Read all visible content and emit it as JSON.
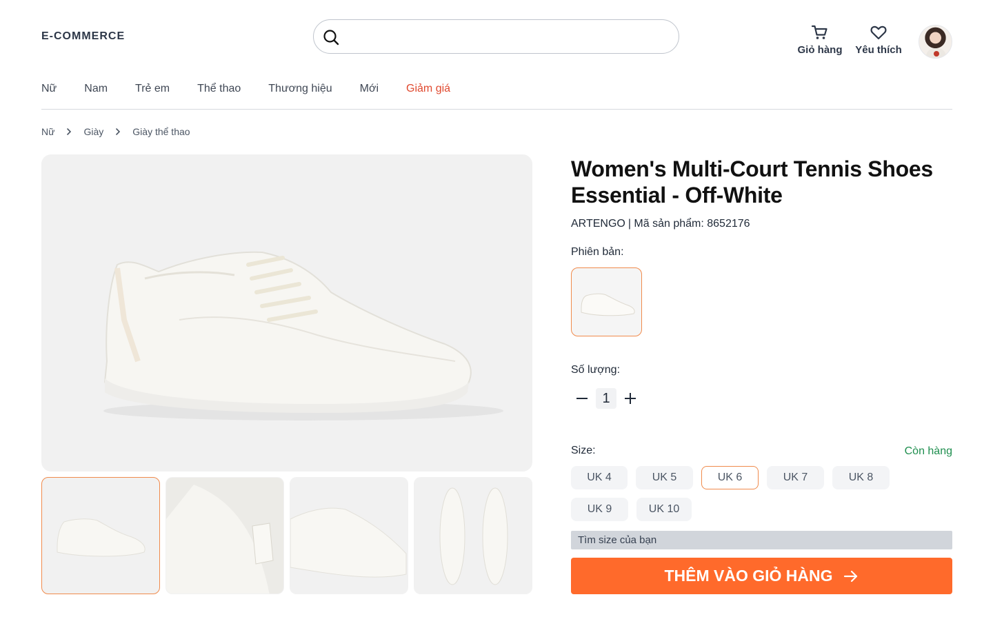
{
  "header": {
    "logo": "E-COMMERCE",
    "search_placeholder": "",
    "cart_label": "Giỏ hàng",
    "favorites_label": "Yêu thích"
  },
  "nav": {
    "items": [
      "Nữ",
      "Nam",
      "Trẻ em",
      "Thể thao",
      "Thương hiệu",
      "Mới",
      "Giảm giá"
    ],
    "sale_color": "#e0492f"
  },
  "breadcrumb": [
    "Nữ",
    "Giày",
    "Giày thể thao"
  ],
  "product": {
    "title": "Women's Multi-Court Tennis Shoes Essential - Off-White",
    "brand": "ARTENGO",
    "sku_label": "| Mã sản phẩm: 8652176",
    "variant_label": "Phiên bản:",
    "quantity_label": "Số lượng:",
    "quantity": "1",
    "size_label": "Size:",
    "stock_status": "Còn hàng",
    "sizes": [
      "UK 4",
      "UK 5",
      "UK 6",
      "UK 7",
      "UK 8",
      "UK 9",
      "UK 10"
    ],
    "selected_size": "UK 6",
    "find_size_label": "Tìm size của bạn",
    "add_to_cart_label": "THÊM VÀO GIỎ HÀNG"
  },
  "colors": {
    "accent": "#ff6a2b",
    "selected_border": "#f08a4b",
    "in_stock": "#1e8e4e"
  }
}
